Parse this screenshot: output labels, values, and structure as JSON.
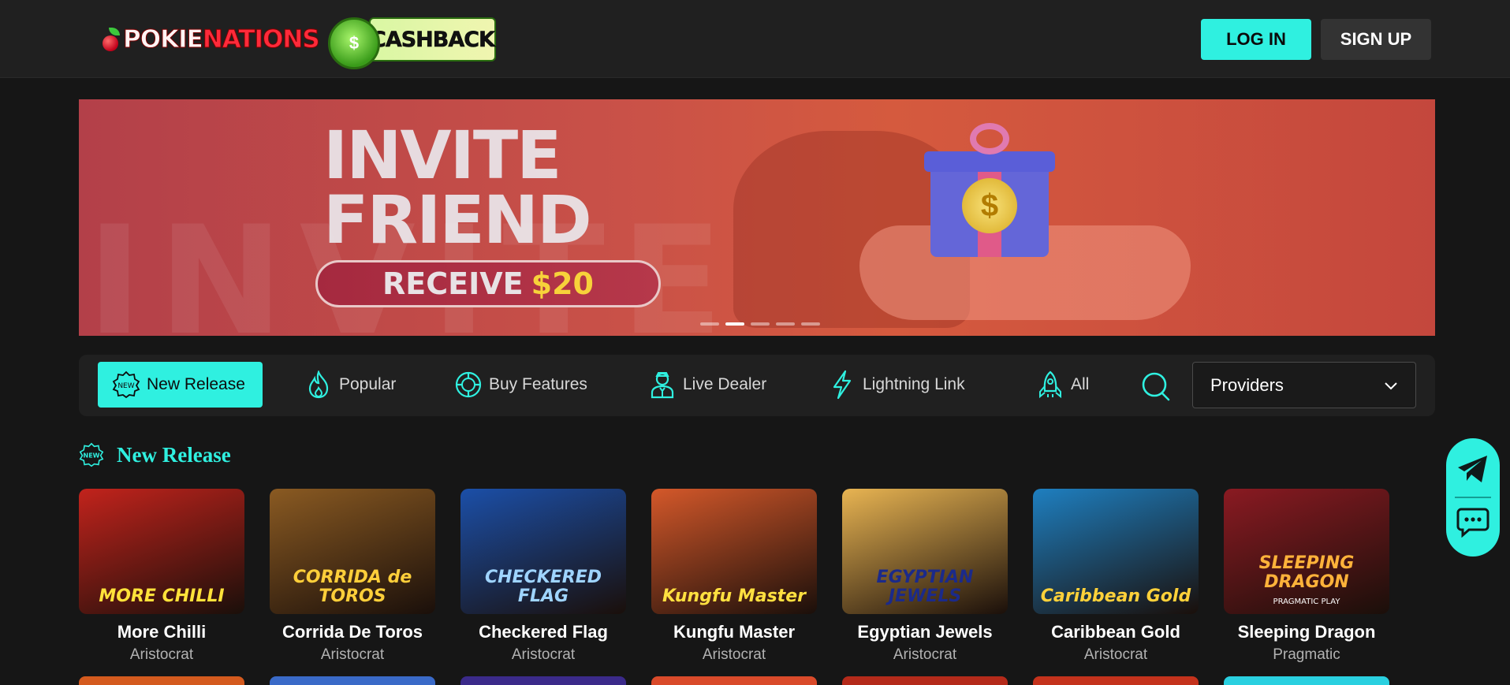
{
  "header": {
    "logo_part1": "POKIE",
    "logo_part2": "NATIONS",
    "cashback_label": "CASHBACK",
    "cashback_symbol": "$",
    "login_label": "LOG IN",
    "signup_label": "SIGN UP"
  },
  "banner": {
    "title_line1": "INVITE",
    "title_line2": "FRIEND",
    "cta_prefix": "RECEIVE",
    "cta_amount": "$20",
    "coin_symbol": "$",
    "slides_total": 5,
    "active_slide": 2
  },
  "filters": {
    "tabs": [
      {
        "label": "New Release",
        "icon": "new-badge-icon",
        "active": true
      },
      {
        "label": "Popular",
        "icon": "flame-icon",
        "active": false
      },
      {
        "label": "Buy Features",
        "icon": "chip-icon",
        "active": false
      },
      {
        "label": "Live Dealer",
        "icon": "dealer-icon",
        "active": false
      },
      {
        "label": "Lightning Link",
        "icon": "lightning-icon",
        "active": false
      },
      {
        "label": "All",
        "icon": "rocket-icon",
        "active": false
      }
    ],
    "new_badge_text": "NEW",
    "providers_label": "Providers"
  },
  "section": {
    "title": "New Release",
    "badge_text": "NEW"
  },
  "games": [
    {
      "name": "More Chilli",
      "provider": "Aristocrat",
      "thumb_title": "MORE CHILLI",
      "bg": "#c2231c",
      "fg": "#ffe23a"
    },
    {
      "name": "Corrida De Toros",
      "provider": "Aristocrat",
      "thumb_title": "CORRIDA de TOROS",
      "bg": "#8a5a22",
      "fg": "#ffcf3a"
    },
    {
      "name": "Checkered Flag",
      "provider": "Aristocrat",
      "thumb_title": "CHECKERED FLAG",
      "bg": "#1b4fa8",
      "fg": "#9fd4ff"
    },
    {
      "name": "Kungfu Master",
      "provider": "Aristocrat",
      "thumb_title": "Kungfu Master",
      "bg": "#d4582a",
      "fg": "#ffe040"
    },
    {
      "name": "Egyptian Jewels",
      "provider": "Aristocrat",
      "thumb_title": "EGYPTIAN JEWELS",
      "bg": "#e8b452",
      "fg": "#1b2a8a"
    },
    {
      "name": "Caribbean Gold",
      "provider": "Aristocrat",
      "thumb_title": "Caribbean Gold",
      "bg": "#1e7fc0",
      "fg": "#ffd13a"
    },
    {
      "name": "Sleeping Dragon",
      "provider": "Pragmatic",
      "thumb_title": "SLEEPING DRAGON",
      "bg": "#8a1a22",
      "fg": "#ffb23a"
    }
  ],
  "thumb_caption_dragon": "PRAGMATIC PLAY",
  "colors": {
    "accent": "#2ff0e0",
    "header_bg": "#202020",
    "page_bg": "#161616"
  }
}
